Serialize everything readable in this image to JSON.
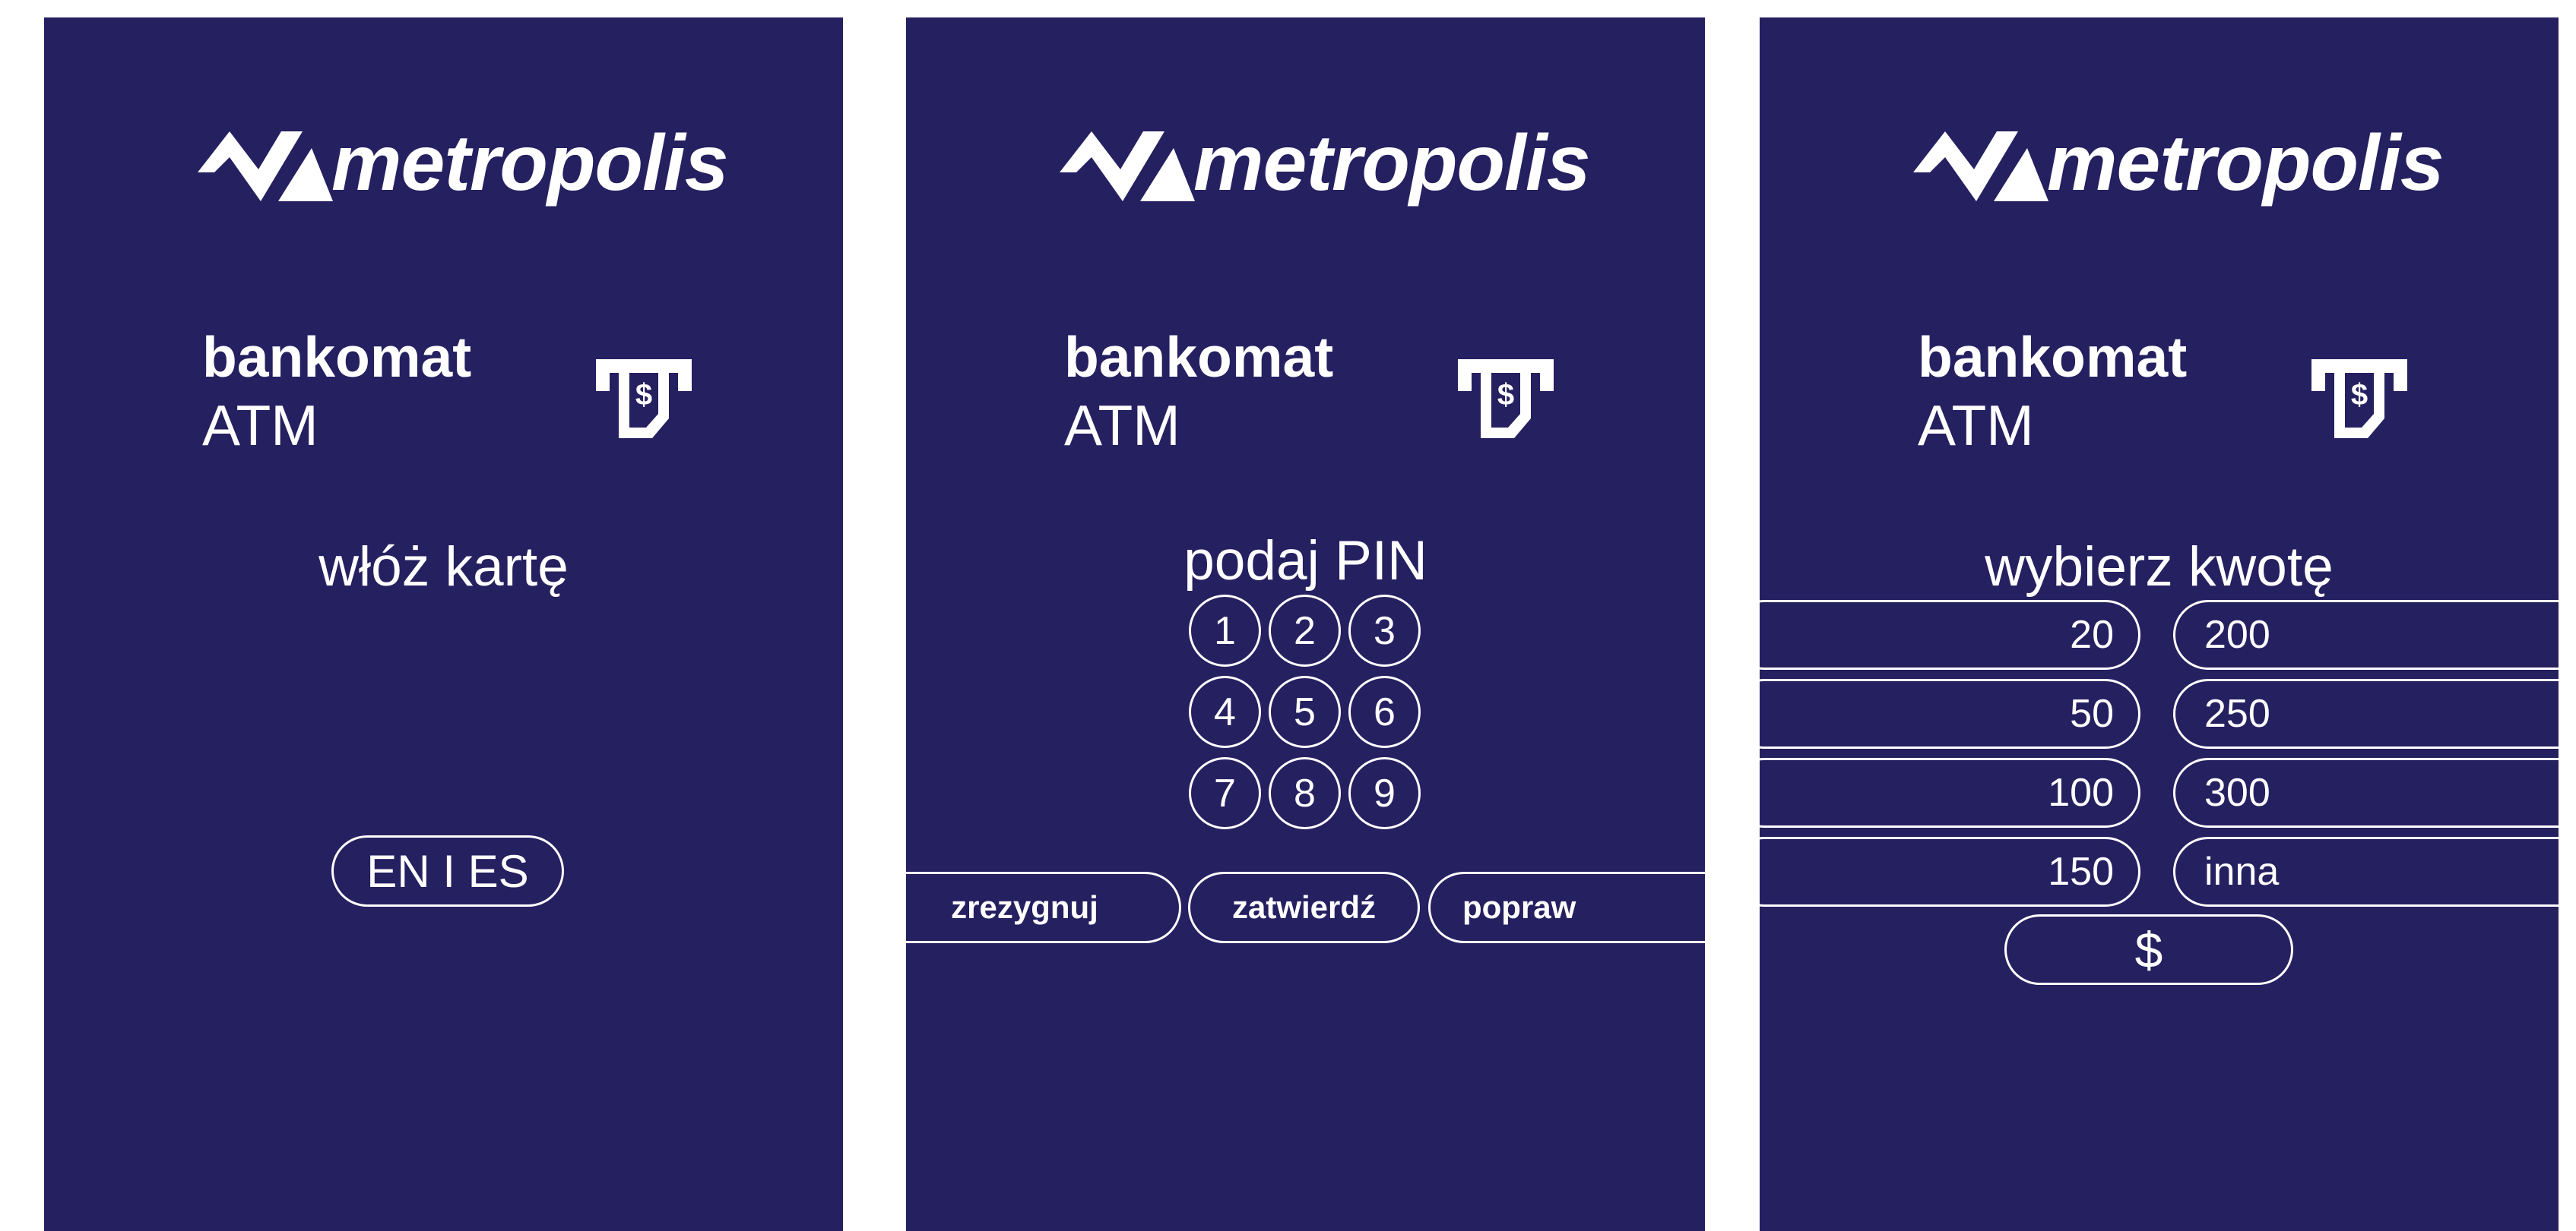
{
  "brand": {
    "name": "metropolis",
    "logo_icon": "metropolis-logo-mark-icon",
    "atm_icon": "atm-cash-dollar-icon"
  },
  "colors": {
    "panel_background": "#252060",
    "foreground": "#ffffff",
    "page_background": "#ffffff"
  },
  "screen_title": {
    "pl": "bankomat",
    "en": "ATM"
  },
  "screens": [
    {
      "id": "insert-card",
      "prompt": "włóż kartę",
      "language_button": "EN I ES"
    },
    {
      "id": "enter-pin",
      "prompt": "podaj PIN",
      "keypad": [
        "1",
        "2",
        "3",
        "4",
        "5",
        "6",
        "7",
        "8",
        "9"
      ],
      "actions": {
        "cancel": "zrezygnuj",
        "confirm": "zatwierdź",
        "correct": "popraw"
      }
    },
    {
      "id": "select-amount",
      "prompt": "wybierz kwotę",
      "amounts_left": [
        "20",
        "50",
        "100",
        "150"
      ],
      "amounts_right": [
        "200",
        "250",
        "300",
        "inna"
      ],
      "cash_button": "$"
    }
  ]
}
